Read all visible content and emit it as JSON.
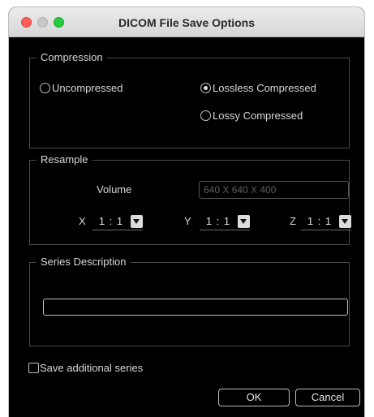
{
  "window": {
    "title": "DICOM File Save Options"
  },
  "compression": {
    "legend": "Compression",
    "options": [
      {
        "label": "Uncompressed",
        "selected": false
      },
      {
        "label": "Lossless Compressed",
        "selected": true
      },
      {
        "label": "Lossy Compressed",
        "selected": false
      }
    ]
  },
  "resample": {
    "legend": "Resample",
    "volume_label": "Volume",
    "volume_value": "640 X 640 X 400",
    "x_label": "X",
    "x_value": "1 : 1",
    "y_label": "Y",
    "y_value": "1 : 1",
    "z_label": "Z",
    "z_value": "1 : 1"
  },
  "series": {
    "legend": "Series Description",
    "value": ""
  },
  "save_additional": {
    "label": "Save additional series",
    "checked": false
  },
  "buttons": {
    "ok": "OK",
    "cancel": "Cancel"
  },
  "colors": {
    "background": "#000000",
    "titlebar": "#e0e0e0",
    "close": "#ff5f57",
    "maximize": "#28c840",
    "minimize_inactive": "#c8c8c8"
  }
}
